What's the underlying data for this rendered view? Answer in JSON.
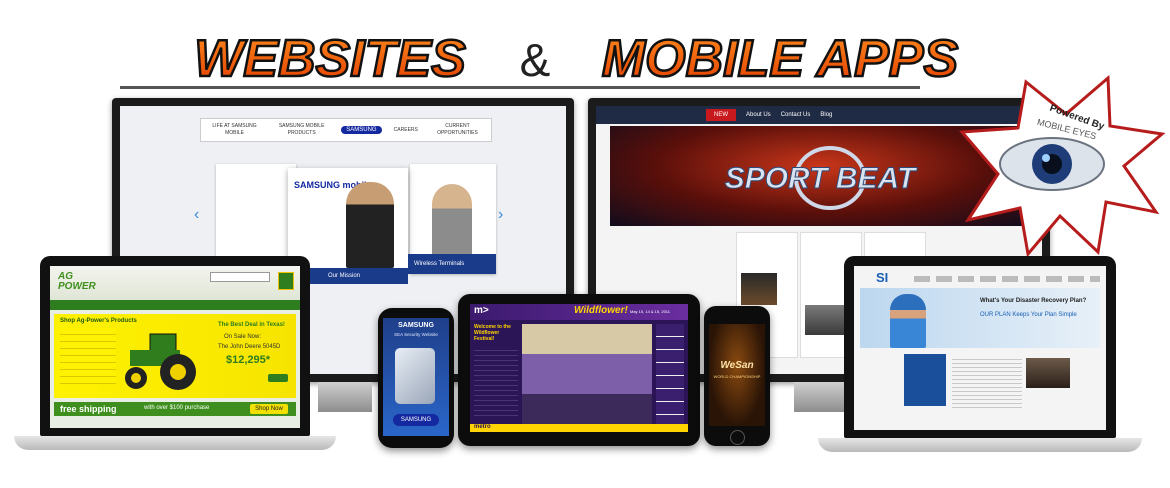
{
  "headline": {
    "left": "WEBSITES",
    "amp": "&",
    "right": "MOBILE APPS"
  },
  "badge": {
    "text": "Powered By",
    "brand": "MOBILE EYES"
  },
  "colors": {
    "headline_orange": "#ff5a00",
    "agpower_green": "#3f8f1e",
    "samsung_blue": "#1428a0",
    "sportsbeat_red": "#c8191e",
    "wildflower_purple": "#3a1f6e"
  },
  "samsung_site": {
    "nav": [
      "LIFE AT SAMSUNG MOBILE",
      "SAMSUNG MOBILE PRODUCTS",
      "SAMSUNG",
      "CAREERS",
      "CURRENT OPPORTUNITIES"
    ],
    "brand": "SAMSUNG mobile",
    "card1_caption": "Our Mission",
    "card2_caption": "Wireless Terminals"
  },
  "sportsbeat_site": {
    "nav": [
      "NEW",
      "About Us",
      "Contact Us",
      "Blog"
    ],
    "hero": "SPORT BEAT"
  },
  "agpower_site": {
    "logo": "AG POWER",
    "promo_title": "Shop Ag-Power's Products",
    "deal_heading": "The Best Deal in Texas!",
    "on_sale": "On Sale Now:",
    "model": "The John Deere 5045D",
    "price": "$12,295*",
    "shipping": "free shipping",
    "shipping_detail": "with over $100 purchase",
    "shop_now": "Shop Now"
  },
  "samsung_phone": {
    "title": "SAMSUNG",
    "subtitle": "SEA Security Website",
    "footer": "SAMSUNG"
  },
  "wildflower_tablet": {
    "logo": "Wildflower!",
    "dates": "May 15, 14 & 15, 2011",
    "welcome": "Welcome to the Wildflower Festival!",
    "bottom_logo": "metro"
  },
  "iphone_app": {
    "title": "WeSan",
    "subtitle": "WORLD CHAMPIONSHIP"
  },
  "si_site": {
    "logo": "SI",
    "hero_title": "What's Your Disaster Recovery Plan?",
    "hero_sub": "OUR PLAN Keeps Your Plan Simple"
  }
}
